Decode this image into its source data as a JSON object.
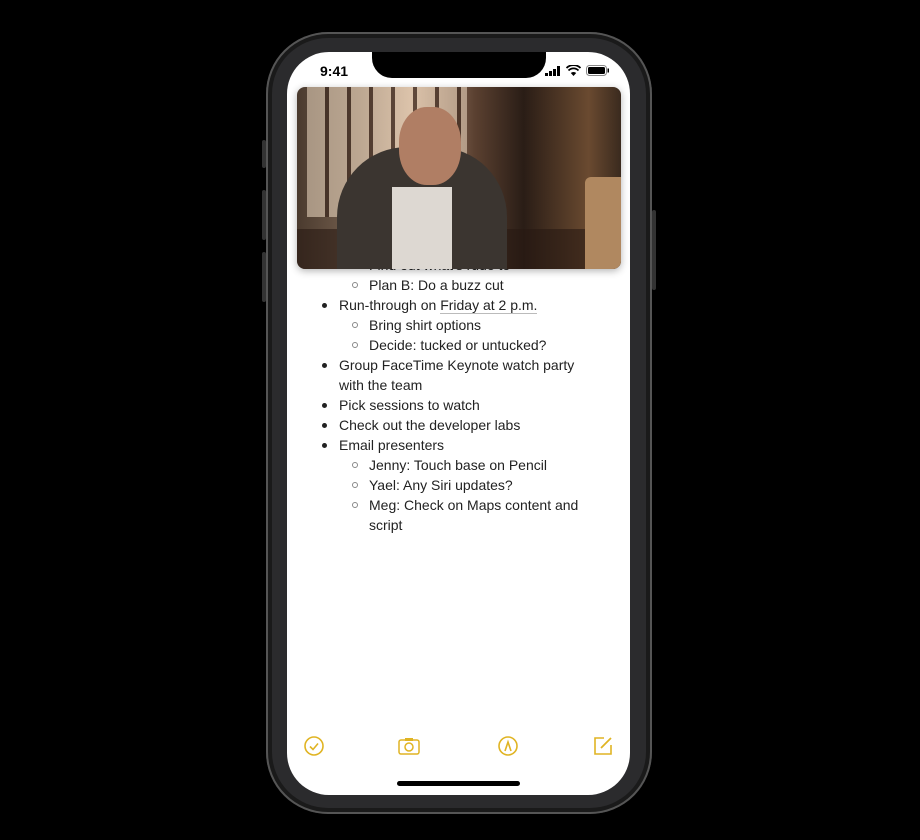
{
  "status_bar": {
    "time": "9:41",
    "icons": [
      "signal-icon",
      "wifi-icon",
      "battery-icon"
    ]
  },
  "video": {
    "description_icon": "picture-in-picture-video"
  },
  "notes": {
    "lines": [
      {
        "text": "Find out what's rude to",
        "level": 2,
        "partial": true
      },
      {
        "text": "Plan B: Do a buzz cut",
        "level": 2
      },
      {
        "text_before": "Run-through on ",
        "link": "Friday at 2 p.m.",
        "level": 1
      },
      {
        "text": "Bring shirt options",
        "level": 2
      },
      {
        "text": "Decide: tucked or untucked?",
        "level": 2
      },
      {
        "text": "Group FaceTime Keynote watch party",
        "level": 1
      },
      {
        "text": "with the team",
        "level": 1,
        "continuation": true
      },
      {
        "text": "Pick sessions to watch",
        "level": 1
      },
      {
        "text": "Check out the developer labs",
        "level": 1
      },
      {
        "text": "Email presenters",
        "level": 1
      },
      {
        "text": "Jenny: Touch base on Pencil",
        "level": 2
      },
      {
        "text": "Yael: Any Siri updates?",
        "level": 2
      },
      {
        "text": "Meg: Check on Maps content and",
        "level": 2
      },
      {
        "text": "script",
        "level": 2,
        "continuation": true
      }
    ]
  },
  "toolbar": {
    "icons": [
      "checklist-icon",
      "camera-icon",
      "markup-icon",
      "compose-icon"
    ],
    "accent": "#e0b423"
  }
}
